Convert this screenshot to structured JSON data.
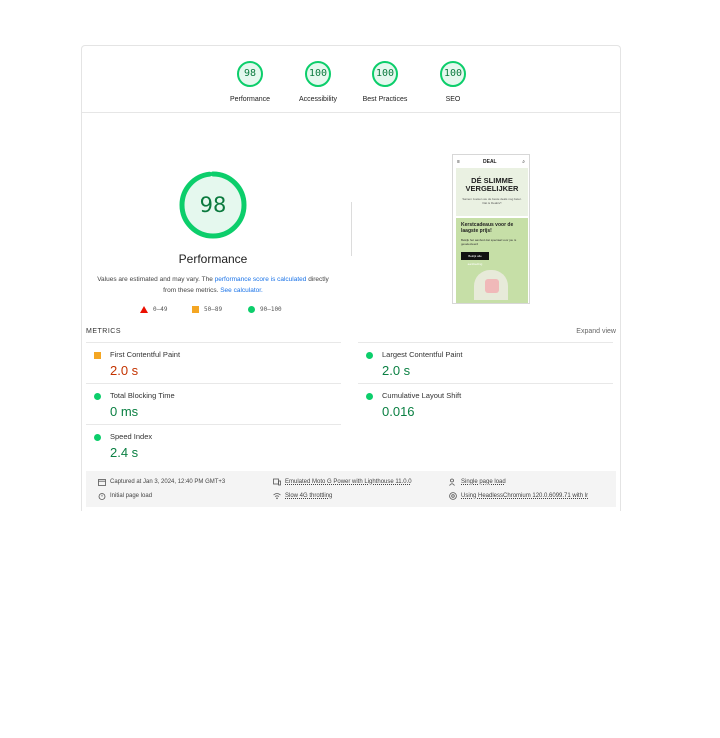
{
  "gauges": [
    {
      "score": "98",
      "label": "Performance",
      "value": 98
    },
    {
      "score": "100",
      "label": "Accessibility",
      "value": 100
    },
    {
      "score": "100",
      "label": "Best Practices",
      "value": 100
    },
    {
      "score": "100",
      "label": "SEO",
      "value": 100
    }
  ],
  "performance": {
    "score": "98",
    "value": 98,
    "title": "Performance",
    "note_prefix": "Values are estimated and may vary. The ",
    "note_link1": "performance score is calculated",
    "note_middle": " directly from these metrics. ",
    "note_link2": "See calculator."
  },
  "legend": {
    "fail": "0–49",
    "average": "50–89",
    "pass": "90–100"
  },
  "screenshot": {
    "menu": "≡",
    "brand": "DEAL",
    "search": "⌕",
    "hero_title": "DÉ SLIMME VERGELIJKER",
    "hero_sub": "Samen zoeken we de beste deals nog beter. Dat is DealsV!",
    "promo_title": "Kerstcadeaus voor de laagste prijs!",
    "promo_text": "Bekijk het aanbod dat speciaal voor jou is geselecteerd",
    "promo_btn": "Bekijk alle aanbieding"
  },
  "metrics": {
    "title": "METRICS",
    "expand": "Expand view",
    "items": [
      {
        "name": "First Contentful Paint",
        "value": "2.0 s",
        "status": "average"
      },
      {
        "name": "Largest Contentful Paint",
        "value": "2.0 s",
        "status": "pass"
      },
      {
        "name": "Total Blocking Time",
        "value": "0 ms",
        "status": "pass"
      },
      {
        "name": "Cumulative Layout Shift",
        "value": "0.016",
        "status": "pass"
      },
      {
        "name": "Speed Index",
        "value": "2.4 s",
        "status": "pass"
      }
    ]
  },
  "footer": {
    "captured": "Captured at Jan 3, 2024, 12:40 PM GMT+3",
    "device": "Emulated Moto G Power with Lighthouse 11.0.0",
    "session": "Single page load",
    "initial": "Initial page load",
    "throttling": "Slow 4G throttling",
    "browser": "Using HeadlessChromium 120.0.6099.71 with lr"
  },
  "colors": {
    "pass": "#0cce6b",
    "pass_text": "#0b8043",
    "average": "#f4a623",
    "average_text": "#c33300",
    "fail": "#eb0f00",
    "link": "#1a73e8"
  }
}
